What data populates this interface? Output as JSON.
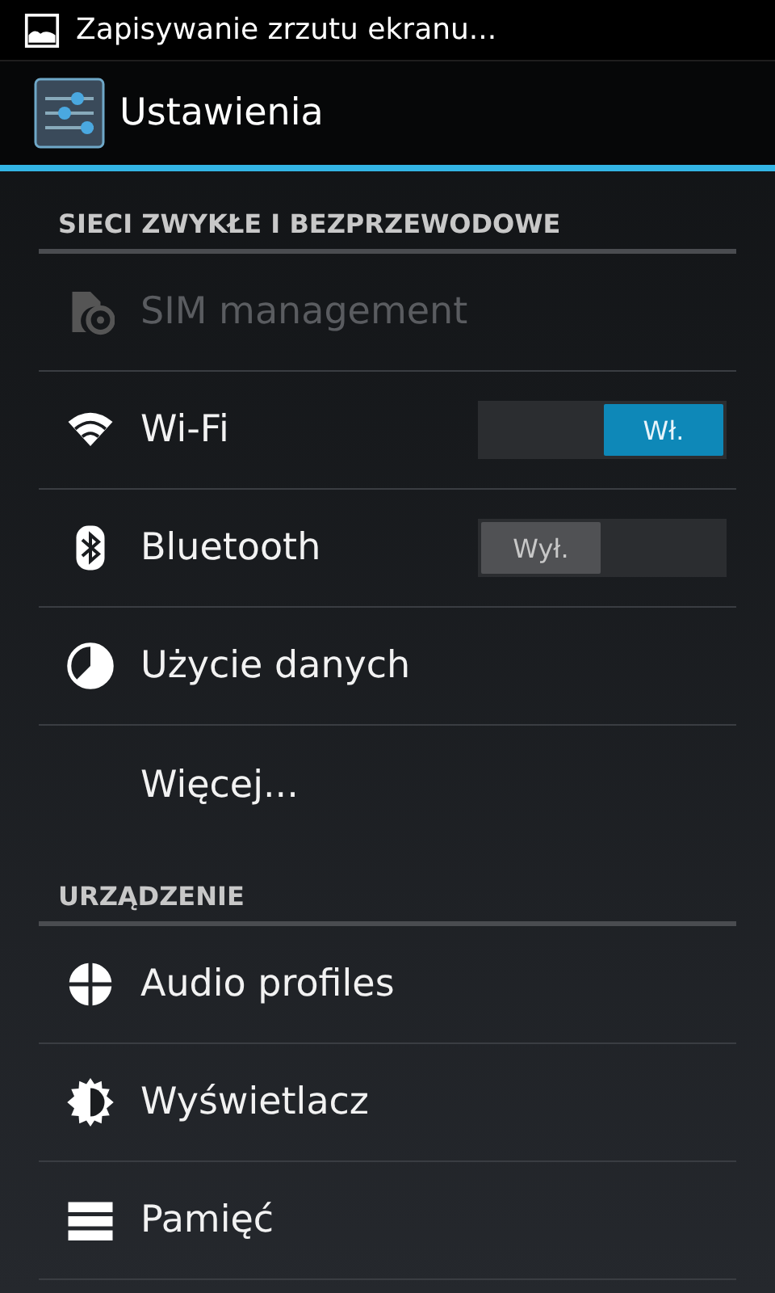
{
  "status_bar": {
    "notification": "Zapisywanie zrzutu ekranu..."
  },
  "action_bar": {
    "title": "Ustawienia"
  },
  "sections": [
    {
      "header": "SIECI ZWYKŁE I BEZPRZEWODOWE",
      "items": [
        {
          "kind": "plain",
          "label": "SIM management",
          "disabled": true
        },
        {
          "kind": "toggle",
          "label": "Wi-Fi",
          "on": true,
          "switch_label": "Wł.",
          "disabled": false
        },
        {
          "kind": "toggle",
          "label": "Bluetooth",
          "on": false,
          "switch_label": "Wył.",
          "disabled": false
        },
        {
          "kind": "plain",
          "label": "Użycie danych",
          "disabled": false
        },
        {
          "kind": "plain",
          "label": "Więcej...",
          "disabled": false
        }
      ]
    },
    {
      "header": "URZĄDZENIE",
      "items": [
        {
          "kind": "plain",
          "label": "Audio profiles",
          "disabled": false
        },
        {
          "kind": "plain",
          "label": "Wyświetlacz",
          "disabled": false
        },
        {
          "kind": "plain",
          "label": "Pamięć",
          "disabled": false
        }
      ]
    }
  ]
}
